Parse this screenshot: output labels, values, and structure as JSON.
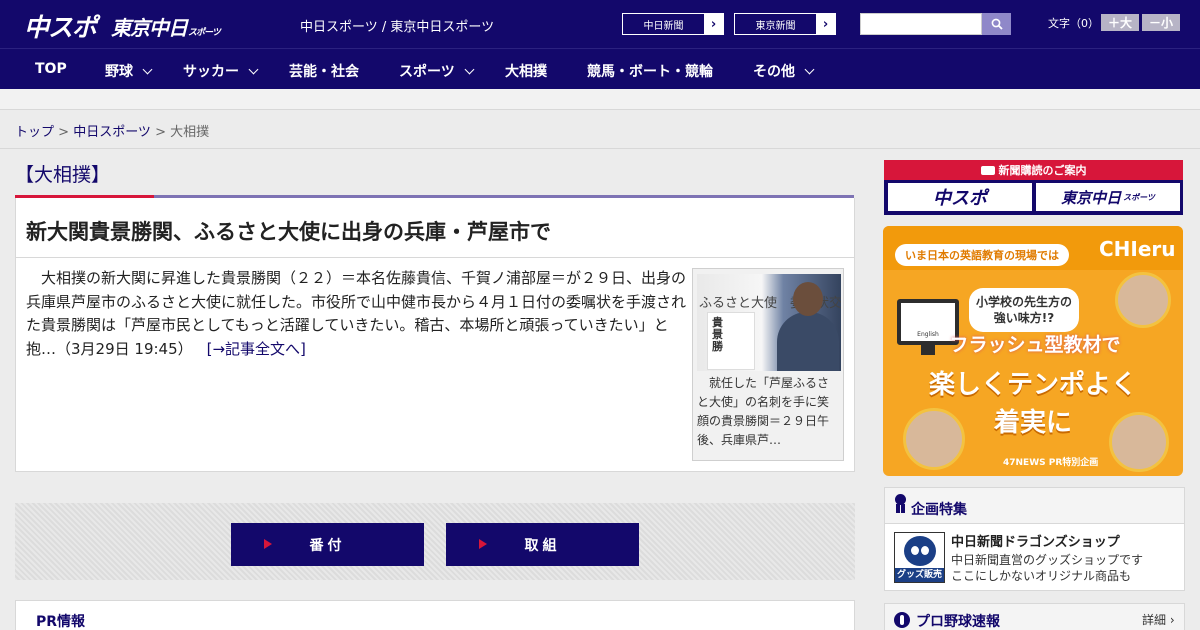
{
  "header": {
    "logo_primary": "中スポ",
    "logo_secondary": "東京中日",
    "logo_secondary_small": "スポーツ",
    "site_title": "中日スポーツ / 東京中日スポーツ",
    "links": [
      {
        "label": "中日新聞"
      },
      {
        "label": "東京新聞"
      }
    ],
    "link_arrow": "›",
    "search": {
      "value": "",
      "placeholder": ""
    },
    "font_size": {
      "label": "文字（0）",
      "increase": "＋大",
      "decrease": "－小"
    }
  },
  "nav": {
    "items": [
      {
        "label": "TOP",
        "has_submenu": false
      },
      {
        "label": "野球",
        "has_submenu": true
      },
      {
        "label": "サッカー",
        "has_submenu": true
      },
      {
        "label": "芸能・社会",
        "has_submenu": false
      },
      {
        "label": "スポーツ",
        "has_submenu": true
      },
      {
        "label": "大相撲",
        "has_submenu": false
      },
      {
        "label": "競馬・ボート・競輪",
        "has_submenu": false
      },
      {
        "label": "その他",
        "has_submenu": true
      }
    ]
  },
  "breadcrumb": {
    "items": [
      {
        "label": "トップ"
      },
      {
        "label": "中日スポーツ"
      },
      {
        "label": "大相撲"
      }
    ],
    "separator": " > "
  },
  "section": {
    "title": "【大相撲】"
  },
  "article": {
    "headline": "新大関貴景勝関、ふるさと大使に出身の兵庫・芦屋市で",
    "body": "大相撲の新大関に昇進した貴景勝関（２２）＝本名佐藤貴信、千賀ノ浦部屋＝が２９日、出身の兵庫県芦屋市のふるさと大使に就任した。市役所で山中健市長から４月１日付の委嘱状を手渡された貴景勝関は「芦屋市民としてもっと活躍していきたい。稽古、本場所と頑張っていきたい」と抱…（3月29日 19:45）",
    "read_more": "[→記事全文へ]",
    "photo_sign_text": "ふるさと大使　委嘱状交",
    "photo_paper_text": "貴景勝",
    "photo_caption": "就任した「芦屋ふるさと大使」の名刺を手に笑顔の貴景勝関＝２９日午後、兵庫県芦…"
  },
  "buttons": [
    {
      "label": "番付"
    },
    {
      "label": "取組"
    }
  ],
  "pr": {
    "title": "PR情報"
  },
  "sidebar": {
    "subscription": {
      "heading": "新聞購読のご案内",
      "buttons": [
        {
          "label": "中スポ"
        },
        {
          "label": "東京中日",
          "small": "スポーツ"
        }
      ]
    },
    "ad": {
      "pill": "いま日本の英語教育の現場では",
      "brand": "CHIeru",
      "speech": "小学校の先生方の強い味方!?",
      "tagline": "フラッシュ型教材で",
      "headline_1": "楽しくテンポよく",
      "headline_2": "着実に",
      "monitor_text": "English",
      "footer": "47NEWS PR特別企画"
    },
    "features": {
      "title": "企画特集",
      "item": {
        "name": "中日新聞ドラゴンズショップ",
        "desc_1": "中日新聞直営のグッズショップです",
        "desc_2": "ここにしかないオリジナル商品も",
        "badge": "グッズ販売中"
      }
    },
    "npb": {
      "title": "プロ野球速報",
      "more": "詳細 ›"
    }
  },
  "colors": {
    "brand_navy": "#13086b",
    "accent_red": "#d7163a",
    "accent_purple": "#7e73b4"
  }
}
